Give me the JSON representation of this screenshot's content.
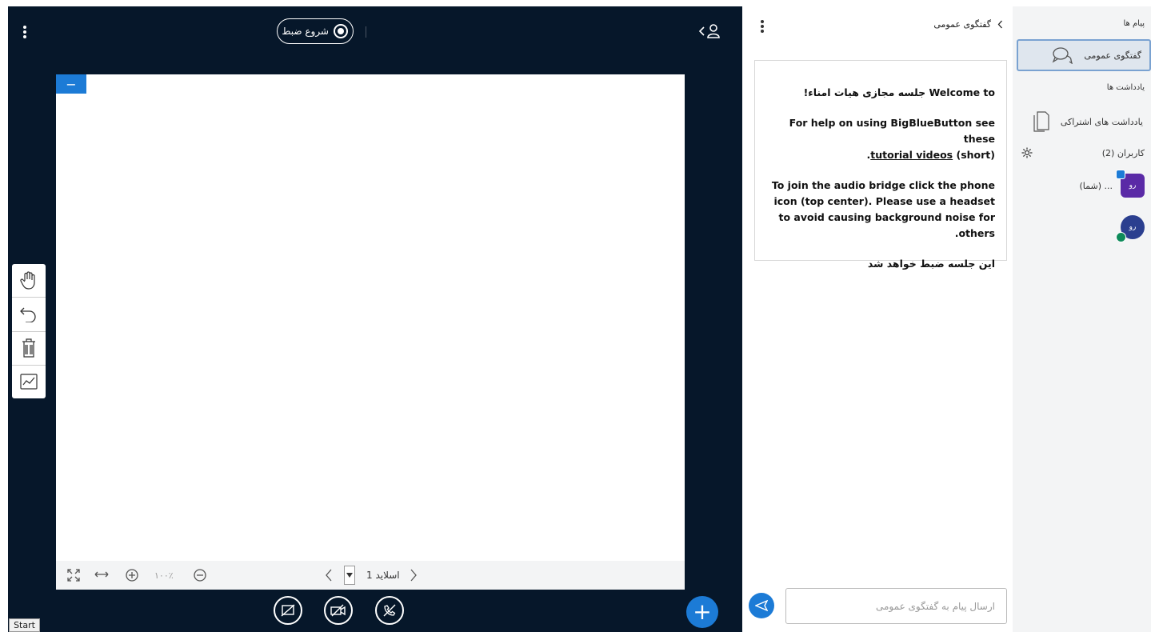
{
  "presentation": {
    "record_label": "شروع ضبط",
    "slide_label": "اسلاید 1",
    "zoom_label": "۱۰۰٪",
    "minimize_label": "−"
  },
  "chat": {
    "title": "گفتگوی عمومی",
    "welcome": {
      "line1_prefix": "Welcome to",
      "line1_meeting": " جلسه مجازی هیات امناء!",
      "line2": "For help on using BigBlueButton see these",
      "line3_paren": "(short) ",
      "line3_link": "tutorial videos",
      "line3_end": ".",
      "line4": "To join the audio bridge click the phone icon (top center). Please use a headset to avoid causing background noise for others.",
      "line5": "این جلسه ضبط خواهد شد"
    },
    "input_placeholder": "ارسال پیام به گفتگوی عمومی"
  },
  "userlist": {
    "messages_header": "پیام ها",
    "public_chat": "گفتگوی عمومی",
    "notes_header": "یادداشت ها",
    "shared_notes": "یادداشت های اشتراکی",
    "users_header": "کاربران (2)",
    "users": [
      {
        "initials": "رو",
        "name": "... (شما)"
      },
      {
        "initials": "رو",
        "name": ""
      }
    ]
  },
  "taskbar": {
    "start_label": "Start"
  }
}
